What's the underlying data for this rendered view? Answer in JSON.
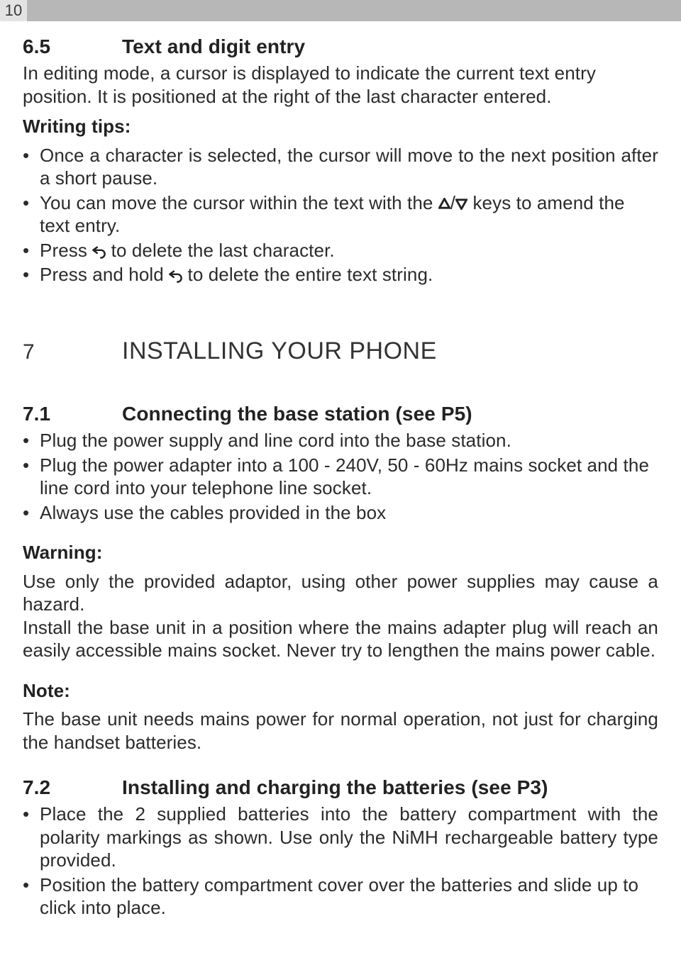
{
  "page_number": "10",
  "section_6_5": {
    "num": "6.5",
    "title": "Text and digit entry",
    "intro": "In editing mode, a cursor is displayed to indicate the current text entry position. It is positioned at the right of the last character entered.",
    "writing_tips_label": "Writing tips:",
    "bullets": {
      "b1": "Once a character is selected, the cursor will move to the next position after a short pause.",
      "b2_pre": "You can move the cursor within the text with the ",
      "b2_post": " keys to amend the text entry.",
      "b3_pre": "Press ",
      "b3_post": " to delete the last character.",
      "b4_pre": "Press and hold ",
      "b4_post": " to delete the entire text string."
    }
  },
  "chapter_7": {
    "num": "7",
    "title": "INSTALLING YOUR PHONE"
  },
  "section_7_1": {
    "num": "7.1",
    "title": "Connecting the base station (see P5)",
    "bullets": {
      "b1": "Plug the power supply and line cord into the base station.",
      "b2": "Plug the power adapter into a 100 - 240V, 50 - 60Hz mains socket and the line cord into your telephone line socket.",
      "b3": "Always use the cables provided in the box"
    },
    "warning_label": "Warning:",
    "warning_text": "Use only the provided adaptor, using other power supplies may cause a hazard.\nInstall the base unit in a position where the mains adapter plug will reach an easily accessible mains socket. Never try to lengthen the mains power cable.",
    "note_label": "Note:",
    "note_text": "The base unit needs mains power for normal operation, not just for charging the handset batteries."
  },
  "section_7_2": {
    "num": "7.2",
    "title": "Installing and charging the batteries (see P3)",
    "bullets": {
      "b1": "Place the 2 supplied batteries into the battery compartment with the polarity markings as shown. Use only the NiMH rechargeable battery type provided.",
      "b2": "Position the battery compartment cover over the batteries and slide up to click into place."
    }
  },
  "icons": {
    "up": "up-triangle",
    "down": "down-triangle",
    "slash": "/",
    "back": "back-arrow"
  }
}
